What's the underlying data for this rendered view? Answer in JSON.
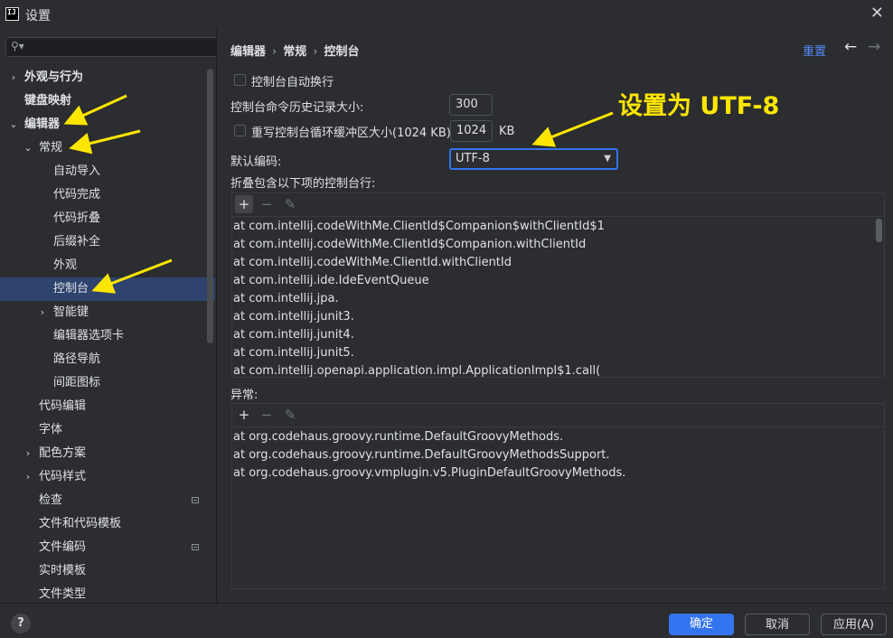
{
  "window": {
    "title": "设置",
    "app_icon_text": "IJ"
  },
  "sidebar": {
    "search_placeholder": "",
    "items": [
      {
        "label": "外观与行为",
        "chevron": "›",
        "level": 0,
        "bold": true
      },
      {
        "label": "键盘映射",
        "chevron": "",
        "level": 0,
        "bold": true
      },
      {
        "label": "编辑器",
        "chevron": "⌄",
        "level": 0,
        "bold": true
      },
      {
        "label": "常规",
        "chevron": "⌄",
        "level": 1,
        "bold": false
      },
      {
        "label": "自动导入",
        "chevron": "",
        "level": 2
      },
      {
        "label": "代码完成",
        "chevron": "",
        "level": 2
      },
      {
        "label": "代码折叠",
        "chevron": "",
        "level": 2
      },
      {
        "label": "后缀补全",
        "chevron": "",
        "level": 2
      },
      {
        "label": "外观",
        "chevron": "",
        "level": 2
      },
      {
        "label": "控制台",
        "chevron": "",
        "level": 2,
        "selected": true
      },
      {
        "label": "智能键",
        "chevron": "›",
        "level": 2
      },
      {
        "label": "编辑器选项卡",
        "chevron": "",
        "level": 2
      },
      {
        "label": "路径导航",
        "chevron": "",
        "level": 2
      },
      {
        "label": "间距图标",
        "chevron": "",
        "level": 2
      },
      {
        "label": "代码编辑",
        "chevron": "",
        "level": 1
      },
      {
        "label": "字体",
        "chevron": "",
        "level": 1
      },
      {
        "label": "配色方案",
        "chevron": "›",
        "level": 1
      },
      {
        "label": "代码样式",
        "chevron": "›",
        "level": 1
      },
      {
        "label": "检查",
        "chevron": "",
        "level": 1,
        "badge": true
      },
      {
        "label": "文件和代码模板",
        "chevron": "",
        "level": 1
      },
      {
        "label": "文件编码",
        "chevron": "",
        "level": 1,
        "badge": true
      },
      {
        "label": "实时模板",
        "chevron": "",
        "level": 1
      },
      {
        "label": "文件类型",
        "chevron": "",
        "level": 1
      }
    ]
  },
  "breadcrumb": {
    "part1": "编辑器",
    "part2": "常规",
    "part3": "控制台",
    "separator": "›"
  },
  "header": {
    "reset": "重置",
    "back_icon": "←",
    "forward_icon": "→"
  },
  "settings": {
    "soft_wrap_label": "控制台自动换行",
    "history_label": "控制台命令历史记录大小:",
    "history_value": "300",
    "override_buffer_label": "重写控制台循环缓冲区大小(1024 KB)",
    "buffer_value": "1024",
    "buffer_unit": "KB",
    "encoding_label": "默认编码:",
    "encoding_value": "UTF-8",
    "fold_label": "折叠包含以下项的控制台行:",
    "exceptions_label": "异常:"
  },
  "fold_list": {
    "toolbar": {
      "add": "+",
      "remove": "−",
      "edit": "✎"
    },
    "rows": [
      "at com.intellij.codeWithMe.ClientId$Companion$withClientId$1",
      "at com.intellij.codeWithMe.ClientId$Companion.withClientId",
      "at com.intellij.codeWithMe.ClientId.withClientId",
      "at com.intellij.ide.IdeEventQueue",
      "at com.intellij.jpa.",
      "at com.intellij.junit3.",
      "at com.intellij.junit4.",
      "at com.intellij.junit5.",
      "at com.intellij.openapi.application.impl.ApplicationImpl$1.call("
    ]
  },
  "exceptions_list": {
    "toolbar": {
      "add": "+",
      "remove": "−",
      "edit": "✎"
    },
    "rows": [
      "at org.codehaus.groovy.runtime.DefaultGroovyMethods.",
      "at org.codehaus.groovy.runtime.DefaultGroovyMethodsSupport.",
      "at org.codehaus.groovy.vmplugin.v5.PluginDefaultGroovyMethods."
    ]
  },
  "footer": {
    "help": "?",
    "ok": "确定",
    "cancel": "取消",
    "apply": "应用(A)"
  },
  "annotation": {
    "text": "设置为 UTF-8",
    "color": "#ffe600"
  },
  "colors": {
    "accent": "#3574f0",
    "link": "#548af7",
    "selection": "#2e436e",
    "background": "#2b2d30"
  }
}
